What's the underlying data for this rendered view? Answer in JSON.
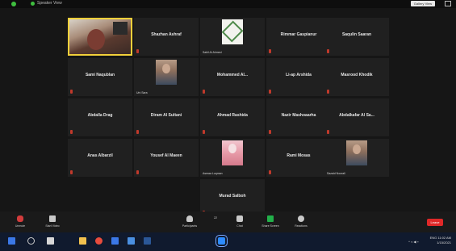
{
  "window": {
    "title": "Speaker View",
    "view_button": "Gallery View",
    "fullscreen_icon": "fullscreen-icon"
  },
  "participants": [
    {
      "name": "",
      "label": "",
      "video": true,
      "style": "webcam",
      "active": true
    },
    {
      "name": "Shazhan Ashraf",
      "label": ""
    },
    {
      "name": "",
      "label": "Sahil Al Ahmed",
      "style": "logo"
    },
    {
      "name": "Rimmar Gaspianur",
      "label": ""
    },
    {
      "name": "Saqulin Saaran",
      "label": ""
    },
    {
      "name": "Sami Naqublan",
      "label": ""
    },
    {
      "name": "",
      "label": "Uni Sara",
      "style": "portrait"
    },
    {
      "name": "Mohammed Al...",
      "label": ""
    },
    {
      "name": "Li-ap Arshida",
      "label": ""
    },
    {
      "name": "Masrood Khodik",
      "label": ""
    },
    {
      "name": "Abdalla Drag",
      "label": ""
    },
    {
      "name": "Diram Al Sultani",
      "label": ""
    },
    {
      "name": "Ahmad Rashida",
      "label": ""
    },
    {
      "name": "Nazir Mashoaarha",
      "label": ""
    },
    {
      "name": "Abdalkafar Al Sa...",
      "label": ""
    },
    {
      "name": "Anas Albarzil",
      "label": ""
    },
    {
      "name": "Yousef Al Maeen",
      "label": ""
    },
    {
      "name": "",
      "label": "Asmaa Luqman",
      "style": "pink"
    },
    {
      "name": "Rami Mosas",
      "label": ""
    },
    {
      "name": "",
      "label": "Sazaid Noorali",
      "style": "portrait"
    },
    {
      "name": "Murad Salboh",
      "label": ""
    }
  ],
  "toolbar": {
    "mute": "Unmute",
    "video": "Start Video",
    "participants": "Participants",
    "participants_count": "22",
    "chat": "Chat",
    "share": "Share Screen",
    "record": "Record",
    "reactions": "Reactions",
    "leave": "Leave"
  },
  "taskbar": {
    "time": "11:02 AM",
    "date": "1/15/2021",
    "lang": "ENG",
    "tray": "^ ≈ ◀ ⌁"
  },
  "colors": {
    "active_border": "#f2d03a",
    "share_green": "#22b04a",
    "leave_red": "#e02828"
  }
}
